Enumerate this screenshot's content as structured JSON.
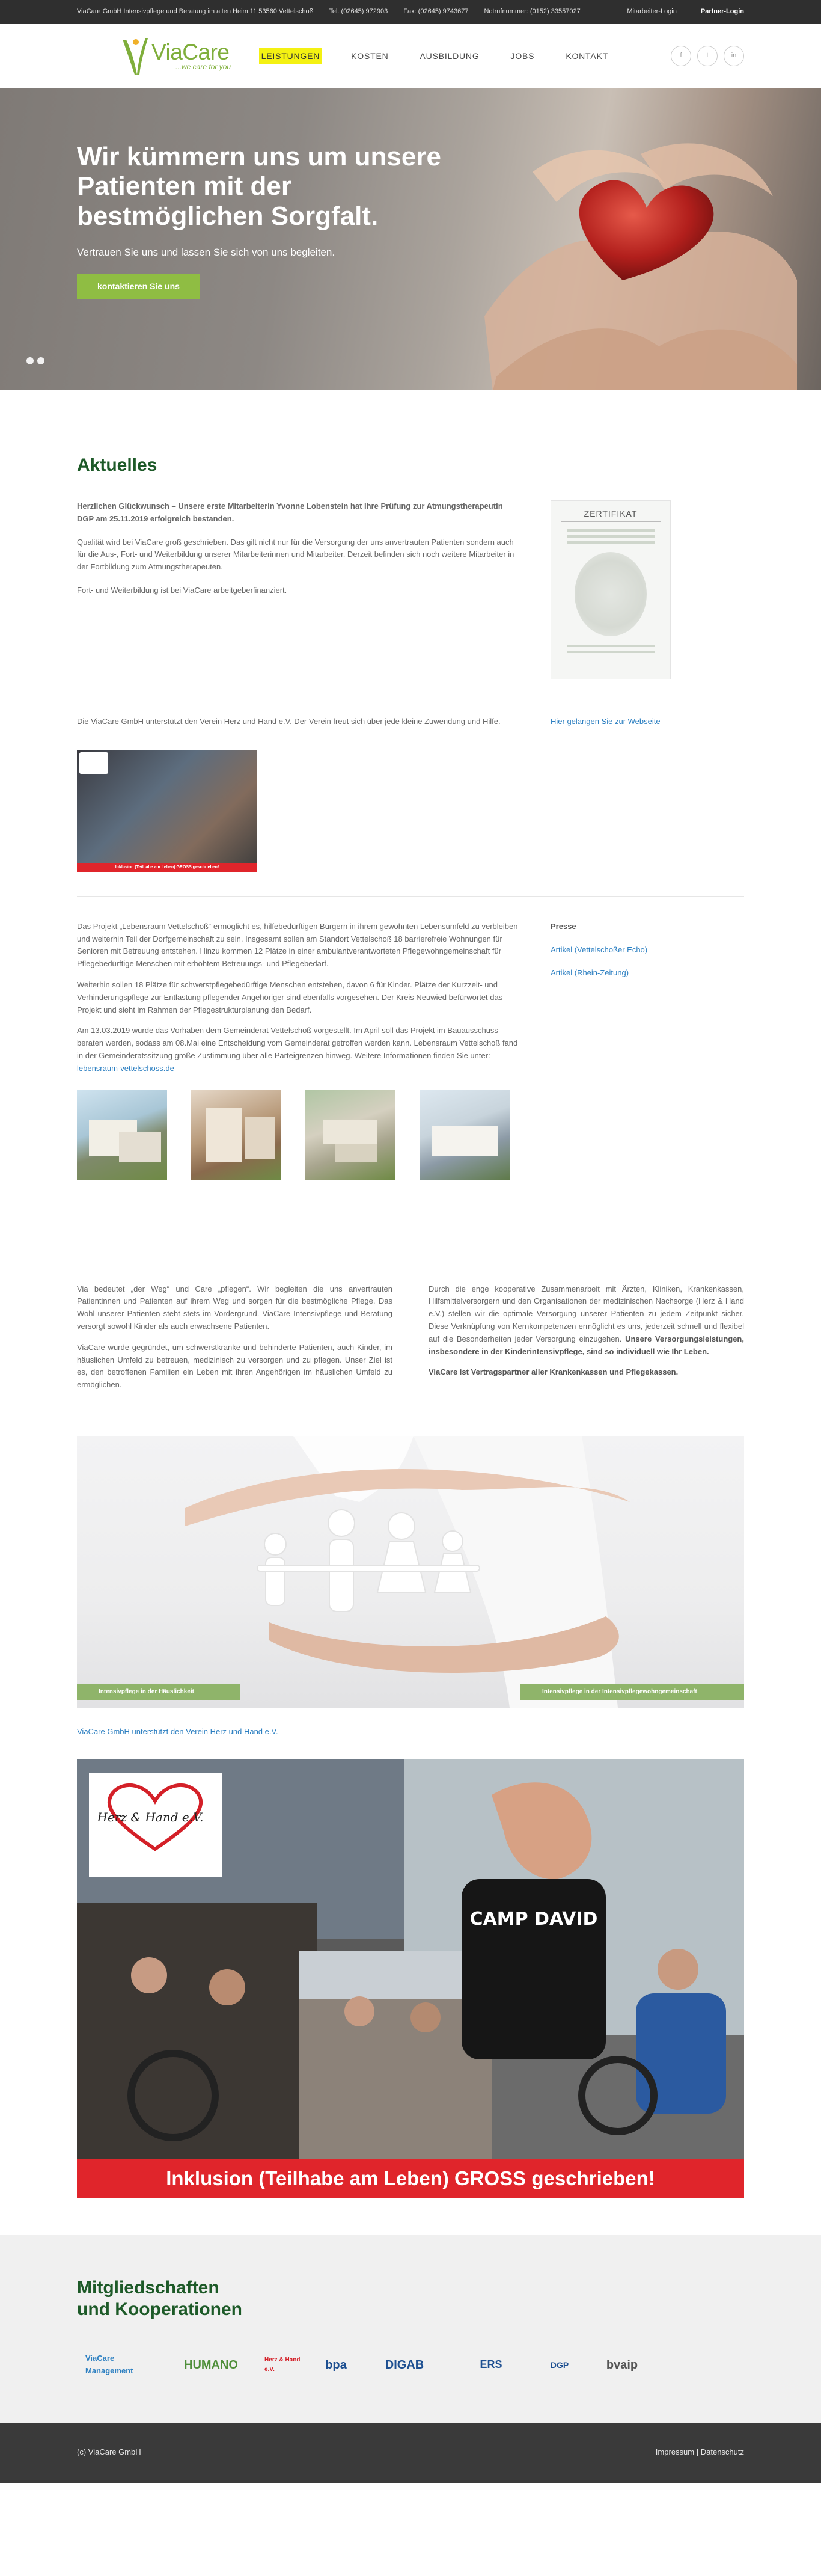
{
  "topbar": {
    "company": "ViaCare GmbH Intensivpflege und Beratung  im alten Heim 11  53560 Vettelschoß",
    "phone": "Tel. (02645) 972903",
    "fax": "Fax: (02645) 9743677",
    "notruf": "Notrufnummer: (0152) 33557027",
    "login": "Mitarbeiter-Login",
    "partner": "Partner-Login"
  },
  "header": {
    "logo_name": "ViaCare",
    "logo_tag": "...we care for you",
    "nav": [
      "LEISTUNGEN",
      "KOSTEN",
      "AUSBILDUNG",
      "JOBS",
      "KONTAKT"
    ],
    "social": [
      "f",
      "t",
      "in"
    ]
  },
  "hero": {
    "title": "Wir kümmern uns um unsere Patienten mit der bestmöglichen Sorgfalt.",
    "subtitle": "Vertrauen Sie uns und lassen Sie sich von uns begleiten.",
    "button": "kontaktieren Sie uns"
  },
  "aktuelles": {
    "title": "Aktuelles",
    "lead": "Herzlichen Glückwunsch – Unsere erste Mitarbeiterin Yvonne Lobenstein hat Ihre Prüfung zur Atmungstherapeutin DGP am 25.11.2019 erfolgreich bestanden.",
    "p1": "Qualität wird bei ViaCare groß geschrieben. Das gilt nicht nur für die Versorgung der uns anvertrauten Patienten sondern auch für die Aus-, Fort- und Weiterbildung unserer Mitarbeiterinnen und Mitarbeiter. Derzeit befinden sich noch weitere Mitarbeiter in der Fortbildung zum Atmungstherapeuten.",
    "p2": "Fort- und Weiterbildung ist bei ViaCare arbeitgeberfinanziert.",
    "certificate_title": "ZERTIFIKAT",
    "herz_text": "Die ViaCare GmbH unterstützt den Verein Herz und Hand e.V. Der Verein freut sich über jede kleine Zuwendung und Hilfe.",
    "herz_link": "Hier gelangen Sie zur Webseite",
    "small_banner": "Inklusion (Teilhabe am Leben) GROSS geschrieben!",
    "project_p1": "Das Projekt „Lebensraum Vettelschoß“ ermöglicht es, hilfebedürftigen Bürgern in ihrem gewohnten Lebensumfeld zu verbleiben und weiterhin Teil der Dorfgemeinschaft zu sein. Insgesamt sollen am Standort Vettelschoß 18 barrierefreie Wohnungen für Senioren mit Betreuung entstehen. Hinzu kommen 12 Plätze in einer ambulantverantworteten Pflegewohngemeinschaft für Pflegebedürftige Menschen mit erhöhtem Betreuungs- und Pflegebedarf.",
    "project_p2": "Weiterhin sollen 18 Plätze für schwerstpflegebedürftige Menschen entstehen, davon 6 für Kinder. Plätze der Kurzzeit- und Verhinderungspflege zur Entlastung pflegender Angehöriger sind ebenfalls vorgesehen. Der Kreis Neuwied befürwortet das Projekt und sieht im Rahmen der Pflegestrukturplanung den Bedarf.",
    "project_p3": "Am 13.03.2019 wurde das Vorhaben dem Gemeinderat Vettelschoß vorgestellt. Im April soll das Projekt im Bauausschuss beraten werden, sodass am 08.Mai eine Entscheidung vom Gemeinderat getroffen werden kann. Lebensraum Vettelschoß fand in der Gemeinderatssitzung große Zustimmung über alle Parteigrenzen hinweg. Weitere Informationen finden Sie unter:",
    "project_link": "lebensraum-vettelschoss.de",
    "presse_title": "Presse",
    "presse_links": [
      "Artikel (Vettelschoßer Echo)",
      "Artikel (Rhein-Zeitung)"
    ]
  },
  "about": {
    "left_p1": "Via bedeutet „der Weg“ und Care „pflegen“. Wir begleiten die uns anvertrauten Patientinnen und Patienten auf ihrem Weg und sorgen für die bestmögliche Pflege. Das Wohl unserer Patienten steht stets im Vordergrund. ViaCare Intensivpflege und Beratung versorgt sowohl Kinder als auch erwachsene Patienten.",
    "left_p2": "ViaCare wurde gegründet, um schwerstkranke und behinderte Patienten, auch Kinder, im häuslichen Umfeld zu betreuen, medizinisch zu versorgen und zu pflegen. Unser Ziel ist es, den betroffenen Familien ein Leben mit ihren Angehörigen im häuslichen Umfeld zu ermöglichen.",
    "right_p1": "Durch die enge kooperative Zusammenarbeit mit Ärzten, Kliniken, Krankenkassen, Hilfsmittelversorgern und den Organisationen der medizinischen Nachsorge (Herz & Hand e.V.) stellen wir die optimale Versorgung unserer Patienten zu jedem Zeitpunkt sicher. Diese Verknüpfung von Kernkompetenzen ermöglicht es uns, jederzeit schnell und flexibel auf die Besonderheiten jeder Versorgung einzugehen.",
    "right_bold": "Unsere Versorgungsleistungen, insbesondere in der Kinderintensivpflege, sind so individuell wie Ihr Leben.",
    "right_p2": "ViaCare ist Vertragspartner aller Krankenkassen und Pflegekassen.",
    "tag_left": "Intensivpflege in der Häuslichkeit",
    "tag_right": "Intensivpflege in der Intensivpflegewohngemeinschaft",
    "herz_link": "ViaCare GmbH unterstützt den Verein Herz und Hand e.V.",
    "collage_banner": "Inklusion (Teilhabe am Leben) GROSS geschrieben!",
    "camp_text": "CAMP DAVID",
    "herz_logo": "Herz & Hand e.V."
  },
  "members": {
    "title_line1": "Mitgliedschaften",
    "title_line2": "und Kooperationen",
    "logos": [
      "ViaCare Management",
      "HUMANO",
      "Herz & Hand e.V.",
      "bpa",
      "DIGAB",
      "ERS",
      "DGP",
      "bvaip"
    ]
  },
  "footer": {
    "copyright": "(c) ViaCare GmbH",
    "impressum": "Impressum",
    "separator": "|",
    "datenschutz": "Datenschutz"
  },
  "colors": {
    "green": "#7fae3b",
    "dark_green": "#1d5a28",
    "link": "#2c7fc1",
    "red": "#e0252b",
    "nav_highlight": "#f4f112"
  }
}
